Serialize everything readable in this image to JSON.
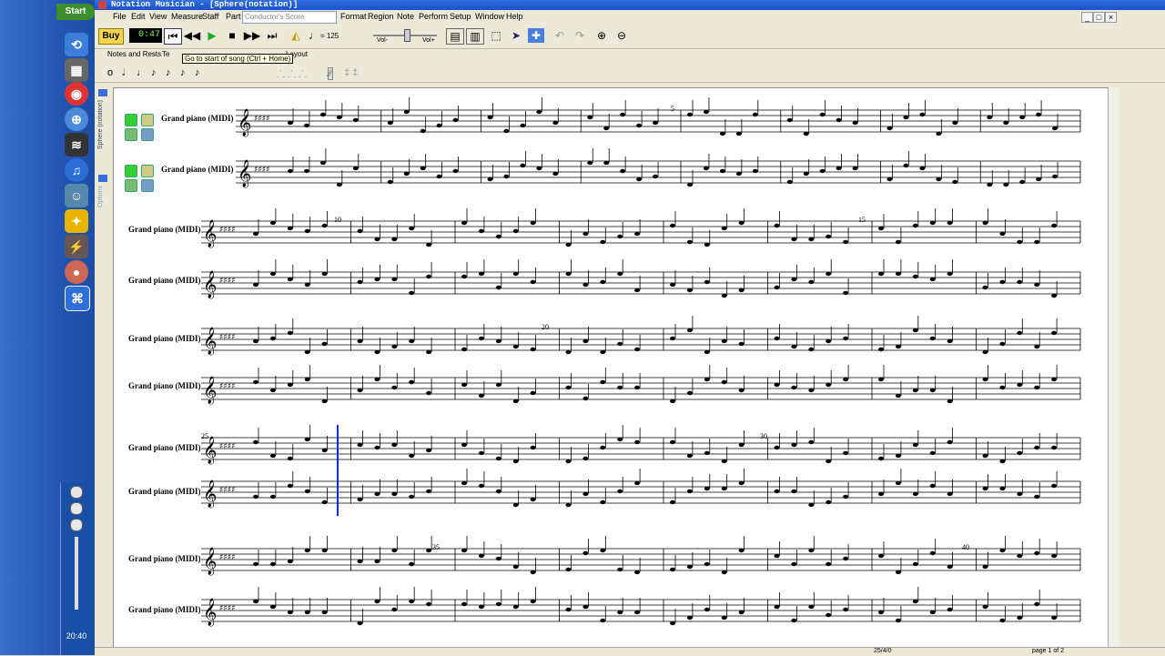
{
  "taskbar": {
    "start_label": "Start",
    "clock": "20:40",
    "icons": [
      "ie-icon",
      "drive-icon",
      "chrome-icon",
      "globe-icon",
      "audio-icon",
      "itunes-icon",
      "messenger-icon",
      "aim-icon",
      "winamp-icon",
      "firefox-icon",
      "app-icon"
    ]
  },
  "window": {
    "title": "Notation Musician - [Sphere(notation)]",
    "controls": [
      "_",
      "□",
      "×"
    ]
  },
  "menu": {
    "items": [
      "File",
      "Edit",
      "View",
      "Measure",
      "Staff",
      "Part"
    ],
    "conductor_placeholder": "Conductor's Score",
    "items2": [
      "Format",
      "Region",
      "Note",
      "Perform",
      "Setup",
      "Window",
      "Help"
    ]
  },
  "toolbar": {
    "buy_label": "Buy",
    "time": "0:47",
    "tempo_value": "= 125",
    "vol_minus": "Vol-",
    "vol_plus": "Vol+",
    "tooltip": "Go to start of song (Ctrl + Home)"
  },
  "tabs": {
    "notes_rests": "Notes and Rests",
    "text": "Te",
    "layout": "Layout"
  },
  "left_strip": {
    "label1": "Sphere (notation)",
    "label2": "Options"
  },
  "score": {
    "instrument": "Grand piano (MIDI)",
    "measure_numbers": [
      "5",
      "10",
      "15",
      "20",
      "25",
      "30",
      "35",
      "40"
    ]
  },
  "status": {
    "position": "25/4/0",
    "page": "page 1 of 2"
  }
}
